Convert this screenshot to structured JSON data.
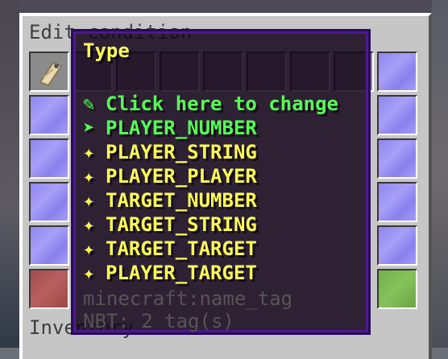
{
  "gui": {
    "title": "Edit condition",
    "inventory_label": "Inventory"
  },
  "tooltip": {
    "title": "Type",
    "change_hint": "Click here to change",
    "change_icon": "feather-icon",
    "selected_icon": "arrow-right-icon",
    "option_icon": "sparkle-icon",
    "selected": "PLAYER_NUMBER",
    "options": [
      "PLAYER_STRING",
      "PLAYER_PLAYER",
      "TARGET_NUMBER",
      "TARGET_STRING",
      "TARGET_TARGET",
      "PLAYER_TARGET"
    ],
    "item_id": "minecraft:name_tag",
    "nbt": "NBT: 2 tag(s)"
  },
  "colors": {
    "title": "#ffff55",
    "selected": "#55ff55",
    "meta": "#555555",
    "pane": "#9a92f4"
  }
}
